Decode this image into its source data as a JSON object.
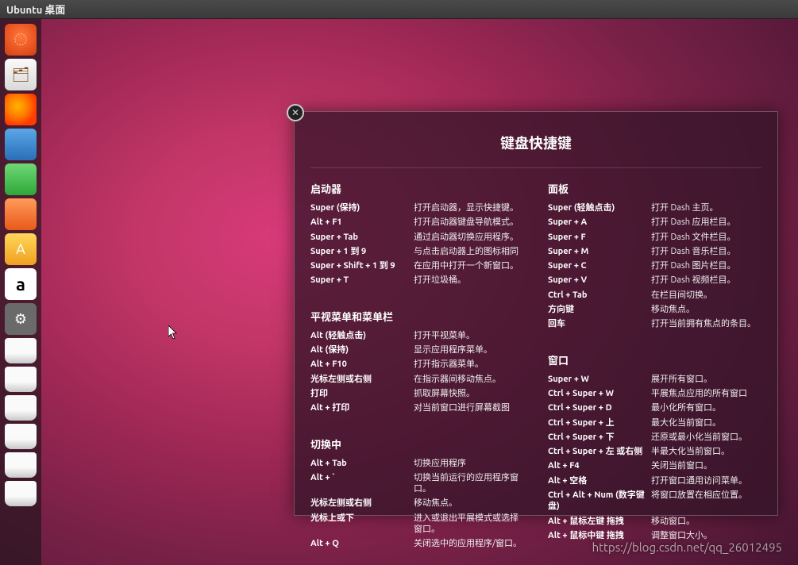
{
  "topbar": {
    "title": "Ubuntu 桌面"
  },
  "launcher": {
    "items": [
      {
        "name": "dash",
        "class": "li-dash",
        "glyph": "◌"
      },
      {
        "name": "files",
        "class": "li-files",
        "glyph": "🗂"
      },
      {
        "name": "firefox",
        "class": "li-firefox",
        "glyph": ""
      },
      {
        "name": "writer",
        "class": "li-writer",
        "glyph": ""
      },
      {
        "name": "calc",
        "class": "li-calc",
        "glyph": ""
      },
      {
        "name": "impress",
        "class": "li-impress",
        "glyph": ""
      },
      {
        "name": "software",
        "class": "li-software",
        "glyph": "A"
      },
      {
        "name": "amazon",
        "class": "li-amazon",
        "glyph": "a"
      },
      {
        "name": "settings",
        "class": "li-settings",
        "glyph": "⚙"
      },
      {
        "name": "drive1",
        "class": "li-drive",
        "glyph": ""
      },
      {
        "name": "drive2",
        "class": "li-drive",
        "glyph": ""
      },
      {
        "name": "drive3",
        "class": "li-drive",
        "glyph": ""
      },
      {
        "name": "drive4",
        "class": "li-drive",
        "glyph": ""
      },
      {
        "name": "drive5",
        "class": "li-drive",
        "glyph": ""
      },
      {
        "name": "drive6",
        "class": "li-drive",
        "glyph": ""
      }
    ]
  },
  "overlay": {
    "title": "键盘快捷键",
    "left": [
      {
        "title": "启动器",
        "rows": [
          {
            "k": "Super (保持)",
            "d": "打开启动器，显示快捷键。"
          },
          {
            "k": "Alt + F1",
            "d": "打开启动器键盘导航模式。"
          },
          {
            "k": "Super + Tab",
            "d": "通过启动器切换应用程序。"
          },
          {
            "k": "Super + 1 到 9",
            "d": "与点击启动器上的图标相同"
          },
          {
            "k": "Super + Shift + 1 到 9",
            "d": "在应用中打开一个新窗口。"
          },
          {
            "k": "Super + T",
            "d": "打开垃圾桶。"
          }
        ]
      },
      {
        "title": "平视菜单和菜单栏",
        "rows": [
          {
            "k": "Alt (轻触点击)",
            "d": "打开平视菜单。"
          },
          {
            "k": "Alt (保持)",
            "d": "显示应用程序菜单。"
          },
          {
            "k": "Alt + F10",
            "d": "打开指示器菜单。"
          },
          {
            "k": "光标左侧或右侧",
            "d": "在指示器间移动焦点。"
          },
          {
            "k": "打印",
            "d": "抓取屏幕快照。"
          },
          {
            "k": "Alt + 打印",
            "d": "对当前窗口进行屏幕截图"
          }
        ]
      },
      {
        "title": "切换中",
        "rows": [
          {
            "k": "Alt + Tab",
            "d": "切换应用程序"
          },
          {
            "k": "Alt + `",
            "d": "切换当前运行的应用程序窗口。"
          },
          {
            "k": "光标左侧或右侧",
            "d": "移动焦点。"
          },
          {
            "k": "光标上或下",
            "d": "进入或退出平展模式或选择窗口。"
          },
          {
            "k": "Alt + Q",
            "d": "关闭选中的应用程序/窗口。"
          }
        ]
      }
    ],
    "right": [
      {
        "title": "面板",
        "rows": [
          {
            "k": "Super (轻触点击)",
            "d": "打开 Dash 主页。"
          },
          {
            "k": "Super + A",
            "d": "打开 Dash 应用栏目。"
          },
          {
            "k": "Super + F",
            "d": "打开 Dash 文件栏目。"
          },
          {
            "k": "Super + M",
            "d": "打开 Dash 音乐栏目。"
          },
          {
            "k": "Super + C",
            "d": "打开 Dash 图片栏目。"
          },
          {
            "k": "Super + V",
            "d": "打开 Dash 视频栏目。"
          },
          {
            "k": "Ctrl + Tab",
            "d": "在栏目间切换。"
          },
          {
            "k": "方向键",
            "d": "移动焦点。"
          },
          {
            "k": "回车",
            "d": "打开当前拥有焦点的条目。"
          }
        ]
      },
      {
        "title": "窗口",
        "rows": [
          {
            "k": "Super + W",
            "d": "展开所有窗口。"
          },
          {
            "k": "Ctrl + Super + W",
            "d": "平展焦点应用的所有窗口"
          },
          {
            "k": "Ctrl + Super + D",
            "d": "最小化所有窗口。"
          },
          {
            "k": "Ctrl + Super + 上",
            "d": "最大化当前窗口。"
          },
          {
            "k": "Ctrl + Super + 下",
            "d": "还原或最小化当前窗口。"
          },
          {
            "k": "Ctrl + Super + 左 或右侧",
            "d": "半最大化当前窗口。"
          },
          {
            "k": "Alt + F4",
            "d": "关闭当前窗口。"
          },
          {
            "k": "Alt + 空格",
            "d": "打开窗口通用访问菜单。"
          },
          {
            "k": "Ctrl + Alt + Num (数字键盘)",
            "d": "将窗口放置在相应位置。"
          },
          {
            "k": "Alt + 鼠标左键 拖拽",
            "d": "移动窗口。"
          },
          {
            "k": "Alt + 鼠标中键 拖拽",
            "d": "调整窗口大小。"
          }
        ]
      }
    ]
  },
  "watermark": "https://blog.csdn.net/qq_26012495"
}
